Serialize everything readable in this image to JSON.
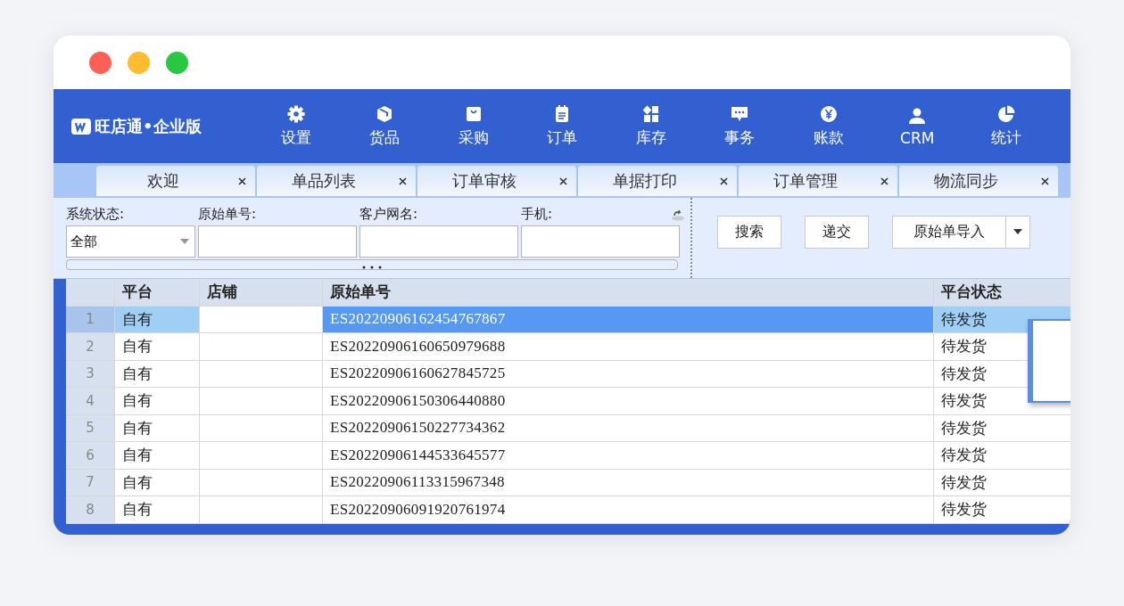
{
  "app": {
    "logo": "旺店通•企业版"
  },
  "nav": [
    {
      "label": "设置",
      "kind": "gear"
    },
    {
      "label": "货品",
      "kind": "cube"
    },
    {
      "label": "采购",
      "kind": "bag"
    },
    {
      "label": "订单",
      "kind": "clipboard"
    },
    {
      "label": "库存",
      "kind": "grid"
    },
    {
      "label": "事务",
      "kind": "chat"
    },
    {
      "label": "账款",
      "kind": "yen"
    },
    {
      "label": "CRM",
      "kind": "person"
    },
    {
      "label": "统计",
      "kind": "pie"
    }
  ],
  "tabs": [
    {
      "label": "欢迎",
      "selected": false
    },
    {
      "label": "单品列表",
      "selected": false
    },
    {
      "label": "订单审核",
      "selected": false
    },
    {
      "label": "单据打印",
      "selected": false
    },
    {
      "label": "订单管理",
      "selected": false
    },
    {
      "label": "物流同步",
      "selected": false
    }
  ],
  "filters": [
    {
      "label": "系统状态:",
      "kind": "select",
      "value": "全部"
    },
    {
      "label": "原始单号:",
      "kind": "text"
    },
    {
      "label": "客户网名:",
      "kind": "text"
    },
    {
      "label": "手机:",
      "kind": "text"
    }
  ],
  "buttons": [
    {
      "label": "搜索",
      "kind": "plain"
    },
    {
      "label": "递交",
      "kind": "plain"
    },
    {
      "label": "原始单导入",
      "kind": "split"
    }
  ],
  "table": {
    "columns": [
      "平台",
      "店铺",
      "原始单号",
      "平台状态"
    ],
    "rows": [
      {
        "index": "1",
        "platform": "自有",
        "order_no": "ES20220906162454767867",
        "status": "待发货",
        "selected": true
      },
      {
        "index": "2",
        "platform": "自有",
        "order_no": "ES20220906160650979688",
        "status": "待发货",
        "selected": false
      },
      {
        "index": "3",
        "platform": "自有",
        "order_no": "ES20220906160627845725",
        "status": "待发货",
        "selected": false
      },
      {
        "index": "4",
        "platform": "自有",
        "order_no": "ES20220906150306440880",
        "status": "待发货",
        "selected": false
      },
      {
        "index": "5",
        "platform": "自有",
        "order_no": "ES20220906150227734362",
        "status": "待发货",
        "selected": false
      },
      {
        "index": "6",
        "platform": "自有",
        "order_no": "ES20220906144533645577",
        "status": "待发货",
        "selected": false
      },
      {
        "index": "7",
        "platform": "自有",
        "order_no": "ES20220906113315967348",
        "status": "待发货",
        "selected": false
      },
      {
        "index": "8",
        "platform": "自有",
        "order_no": "ES20220906091920761974",
        "status": "待发货",
        "selected": false
      }
    ]
  }
}
